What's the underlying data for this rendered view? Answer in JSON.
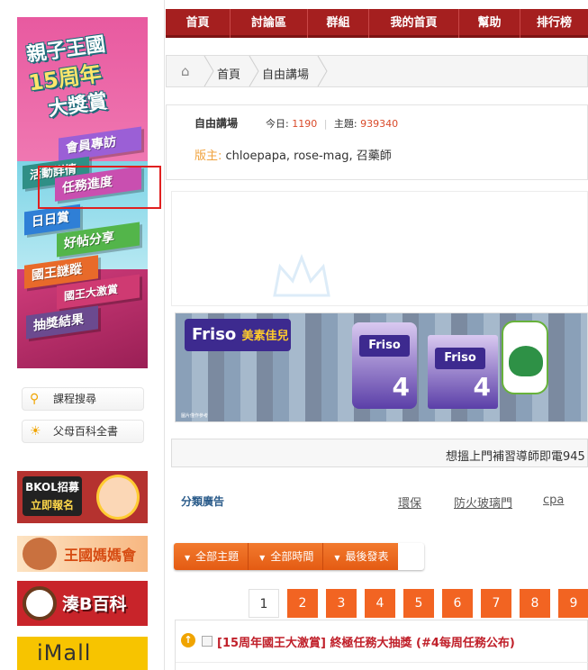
{
  "banner": {
    "title_line1": "親子王國",
    "title_line2": "15周年",
    "title_line3": "大獎賞",
    "items": [
      {
        "label": "會員專訪",
        "color": "#9b5fd6"
      },
      {
        "label": "活動詳情",
        "color": "#2f8f86"
      },
      {
        "label": "任務進度",
        "color": "#c94fb0"
      },
      {
        "label": "日日賞",
        "color": "#2f7fd6"
      },
      {
        "label": "好帖分享",
        "color": "#53b54a"
      },
      {
        "label": "國王謎蹤",
        "color": "#e86a2a"
      },
      {
        "label": "國王大激賞",
        "color": "#cf3a72"
      },
      {
        "label": "抽獎結果",
        "color": "#6b4a8f"
      }
    ]
  },
  "sidebar_links": [
    {
      "label": "課程搜尋",
      "icon": "key-icon"
    },
    {
      "label": "父母百科全書",
      "icon": "lightbulb-icon"
    }
  ],
  "side_ads": {
    "bkol_line1": "BKOL招募",
    "bkol_line2": "立即報名",
    "moms_club": "王國媽媽會",
    "baby_wiki": "湊B百科",
    "imall": "iMall"
  },
  "nav": {
    "items": [
      "首頁",
      "討論區",
      "群組",
      "我的首頁",
      "幫助",
      "排行榜"
    ]
  },
  "breadcrumb": {
    "items": [
      "首頁",
      "自由講場"
    ]
  },
  "forum": {
    "name": "自由講場",
    "today_label": "今日: ",
    "today_value": "1190",
    "topics_label": "主題: ",
    "topics_value": "939340",
    "separator": "|",
    "moderators_label": "版主:",
    "moderators": " chloepapa, rose-mag, 召藥師"
  },
  "friso_ad": {
    "brand": "Friso",
    "brand_cn": "美素佳兒",
    "can_label": "Friso",
    "stage": "4",
    "fine_print": "圖片僅作參考"
  },
  "ticker": {
    "text": "想搵上門補習導師即電945"
  },
  "categories": {
    "label": "分類廣告",
    "links": [
      "環保",
      "防火玻璃門",
      "cpa"
    ]
  },
  "filters": {
    "items": [
      "全部主題",
      "全部時間",
      "最後發表"
    ]
  },
  "pager": {
    "pages": [
      "1",
      "2",
      "3",
      "4",
      "5",
      "6",
      "7",
      "8",
      "9"
    ],
    "current": "1"
  },
  "thread": {
    "title": "[15周年國王大激賞] 終極任務大抽獎 (#4每周任務公布)"
  }
}
